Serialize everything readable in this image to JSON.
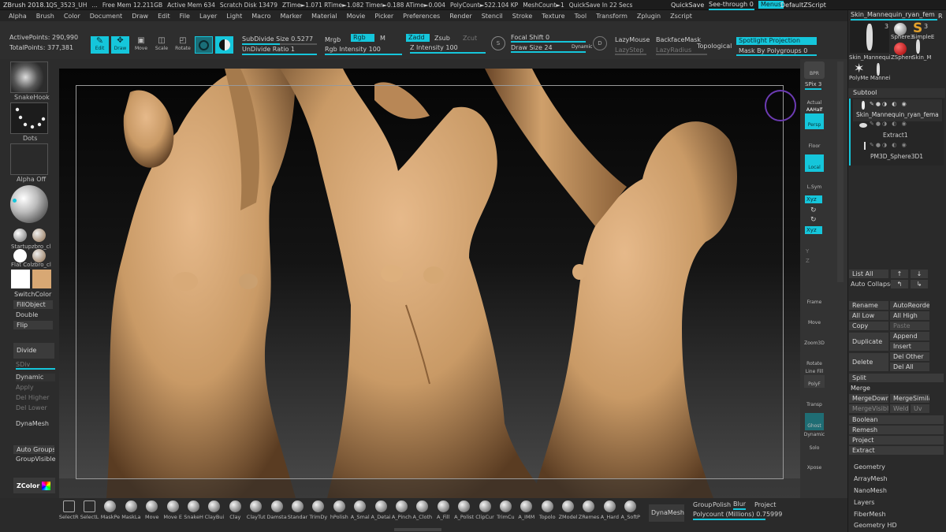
{
  "title_bar": {
    "app": "ZBrush 2018.1",
    "items": [
      "QS_3523_UH",
      "…",
      "Free Mem 12.211GB",
      "Active Mem 634",
      "Scratch Disk 13479",
      "ZTime►1.071 RTime►1.082 Timer►0.188 ATime►0.004",
      "PolyCount►522.104 KP",
      "MeshCount►1",
      "QuickSave In 22 Secs"
    ],
    "quicksave": "QuickSave",
    "see_through": "See-through  0",
    "menus": "Menus",
    "script": "DefaultZScript"
  },
  "menu_bar": [
    "Alpha",
    "Brush",
    "Color",
    "Document",
    "Draw",
    "Edit",
    "File",
    "Layer",
    "Light",
    "Macro",
    "Marker",
    "Material",
    "Movie",
    "Picker",
    "Preferences",
    "Render",
    "Stencil",
    "Stroke",
    "Texture",
    "Tool",
    "Transform",
    "Zplugin",
    "Zscript"
  ],
  "stats": {
    "active_points": "ActivePoints: 290,990",
    "total_points": "TotalPoints: 377,381"
  },
  "tools": {
    "edit": "Edit",
    "draw": "Draw",
    "move": "Move",
    "scale": "Scale",
    "rotate": "Rotate"
  },
  "shelf": {
    "subdivide_size": "SubDivide Size 0.5277",
    "undivide_ratio": "UnDivide Ratio 1",
    "mrgb": "Mrgb",
    "rgb": "Rgb",
    "m": "M",
    "rgb_intensity": "Rgb Intensity 100",
    "zadd": "Zadd",
    "zsub": "Zsub",
    "zcut": "Zcut",
    "z_intensity": "Z Intensity 100",
    "focal_shift": "Focal Shift 0",
    "draw_size": "Draw Size 24",
    "dynamic": "Dynamic",
    "lazymouse": "LazyMouse",
    "lazystep": "LazyStep",
    "backface_mask": "BackfaceMask",
    "lazyradius": "LazyRadius",
    "topological": "Topological",
    "spotlight": "Spotlight Projection",
    "mask_by_polygroups": "Mask By Polygroups 0"
  },
  "left_panel": {
    "snakehook": "SnakeHook",
    "dots": "Dots",
    "alpha_off": "Alpha Off",
    "mat1": "Startupzbro_cl",
    "mat2": "Flat Colzbro_cl",
    "switch_color": "SwitchColor",
    "fill_object": "FillObject",
    "double": "Double",
    "flip": "Flip",
    "divide": "Divide",
    "sdiv": "SDiv",
    "dynamic": "Dynamic",
    "apply": "Apply",
    "del_higher": "Del Higher",
    "del_lower": "Del Lower",
    "dynamesh": "DynaMesh",
    "auto_groups": "Auto Groups",
    "group_visible": "GroupVisible",
    "zcolor": "ZColor"
  },
  "right_icons": {
    "bpr": "BPR",
    "spix": "SPix 3",
    "actual": "Actual",
    "aahalf": "AAHalf",
    "persp": "Persp",
    "floor": "Floor",
    "local": "Local",
    "lsym": "L.Sym",
    "xyz1": "Xyz",
    "xyz2": "Xyz",
    "y": "Y",
    "z": "Z",
    "frame": "Frame",
    "move": "Move",
    "zoom3d": "Zoom3D",
    "rotate": "Rotate",
    "lineFill": "Line Fill",
    "polyf": "PolyF",
    "transp": "Transp",
    "ghost": "Ghost",
    "dynamic": "Dynamic",
    "solo": "Solo",
    "xpose": "Xpose"
  },
  "tool_panel": {
    "current": "Skin_Mannequin_ryan_fem",
    "r": "R",
    "thumbs": [
      "Skin_Mannequi",
      "Sphere3",
      "SimpleE",
      "PolyMe",
      "ZSphere",
      "Skin_M",
      "PolyMe Mannei"
    ],
    "count1": "3",
    "count2": "3"
  },
  "subtool": {
    "header": "Subtool",
    "items": [
      "Skin_Mannequin_ryan_fema",
      "Extract1",
      "PM3D_Sphere3D1"
    ]
  },
  "subtool_buttons": {
    "list_all": "List All",
    "auto_collapse": "Auto Collapse",
    "rename": "Rename",
    "auto_reorder": "AutoReorder",
    "all_low": "All Low",
    "all_high": "All High",
    "copy": "Copy",
    "paste": "Paste",
    "duplicate": "Duplicate",
    "append": "Append",
    "insert": "Insert",
    "delete": "Delete",
    "del_other": "Del Other",
    "del_all": "Del All",
    "split": "Split",
    "merge": "Merge",
    "merge_down": "MergeDown",
    "merge_similar": "MergeSimilar",
    "merge_visible": "MergeVisible",
    "weld": "Weld",
    "uv": "Uv",
    "boolean": "Boolean",
    "remesh": "Remesh",
    "project": "Project",
    "extract": "Extract"
  },
  "sections": [
    "Geometry",
    "ArrayMesh",
    "NanoMesh",
    "Layers",
    "FiberMesh",
    "Geometry HD"
  ],
  "brushes": [
    "SelectR",
    "SelectL",
    "MaskPe",
    "MaskLa",
    "Move",
    "Move E",
    "SnakeH",
    "ClayBui",
    "Clay",
    "ClayTut",
    "Damsta",
    "Standar",
    "TrimDy",
    "hPolish",
    "A_Smal",
    "A_Detai",
    "A_Pinch",
    "A_Cloth",
    "A_Fill",
    "A_Polist",
    "ClipCur",
    "TrimCu",
    "A_IMM",
    "Topolo",
    "ZModel",
    "ZRemes",
    "A_Hard",
    "A_SoftP"
  ],
  "bottom_right": {
    "dynamesh": "DynaMesh",
    "group": "Group",
    "polish": "Polish",
    "blur": "Blur",
    "project": "Project",
    "polycount": "Polycount (Millions) 0.75999"
  },
  "colors": {
    "accent": "#15c6db",
    "skin": "#c99a66",
    "bg": "#2c2c2c"
  }
}
